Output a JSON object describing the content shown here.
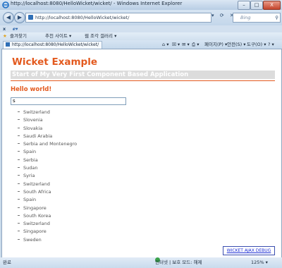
{
  "window": {
    "title": "http://localhost:8080/HelloWicket/wicket/ - Windows Internet Explorer",
    "min_label": "–",
    "max_label": "□",
    "close_label": "X"
  },
  "address": {
    "back_icon": "◀",
    "forward_icon": "▶",
    "url": "http://localhost:8080/HelloWicket/wicket/",
    "tool_icons": "▾ ⟳ ✕",
    "search_placeholder": "Bing",
    "search_icon": "⚲"
  },
  "menu": {
    "x_label": "x",
    "ie_label": "ℯ▾"
  },
  "favorites": {
    "star": "★",
    "favorites_label": "즐겨찾기",
    "suggested_label": "추천 사이트 ▾",
    "gallery_label": "웹 조각 갤러리 ▾"
  },
  "tabs": {
    "active_title": "http://localhost:8080/HelloWicket/wicket/",
    "commands": [
      "⌂ ▾",
      "☒ ▾",
      "✉ ▾",
      "⎙ ▾",
      "페이지(P) ▾",
      "안전(S) ▾",
      "도구(O) ▾",
      "? ▾"
    ]
  },
  "page": {
    "heading": "Wicket Example",
    "subheading": "Start of My Very First Component Based Application",
    "hello": "Hello world!",
    "input_value": "s",
    "countries": [
      "Switzerland",
      "Slovenia",
      "Slovakia",
      "Saudi Arabia",
      "Serbia and Montenegro",
      "Spain",
      "Serbia",
      "Sudan",
      "Syria",
      "Switzerland",
      "South Africa",
      "Spain",
      "Singapore",
      "South Korea",
      "Switzerland",
      "Singapore",
      "Sweden"
    ],
    "ajax_debug": "WICKET AJAX DEBUG"
  },
  "status": {
    "left": "완료",
    "zone": "인터넷 | 보호 모드: 해제",
    "zoom": "125% ▾"
  },
  "colors": {
    "accent": "#e35a1f",
    "link": "#1a2cd4"
  }
}
